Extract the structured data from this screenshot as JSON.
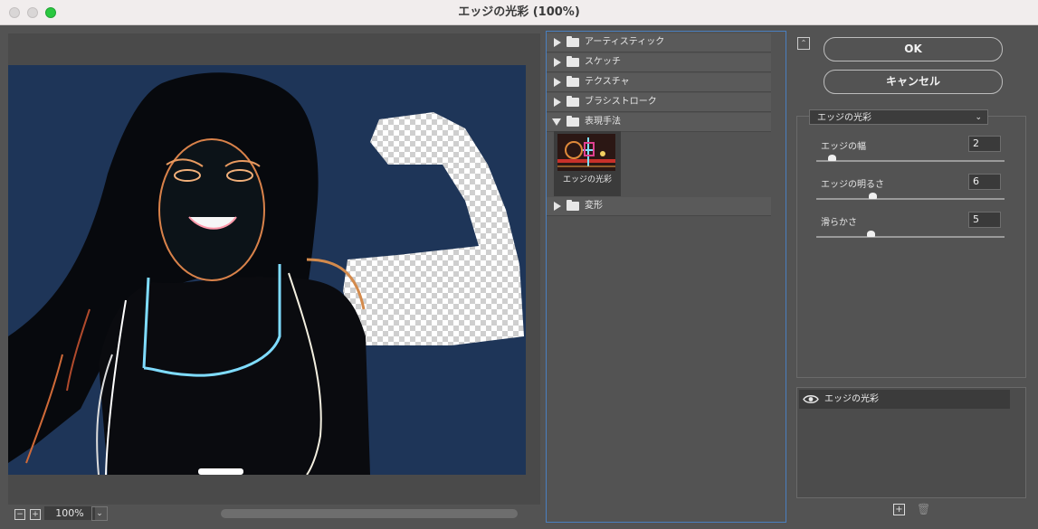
{
  "window": {
    "title": "エッジの光彩 (100%)"
  },
  "preview": {
    "zoom": "100%",
    "zoom_out": "−",
    "zoom_in": "+"
  },
  "filter_groups": [
    {
      "label": "アーティスティック",
      "expanded": false
    },
    {
      "label": "スケッチ",
      "expanded": false
    },
    {
      "label": "テクスチャ",
      "expanded": false
    },
    {
      "label": "ブラシストローク",
      "expanded": false
    },
    {
      "label": "表現手法",
      "expanded": true
    },
    {
      "label": "変形",
      "expanded": false
    }
  ],
  "selected_filter": {
    "label": "エッジの光彩"
  },
  "buttons": {
    "ok": "OK",
    "cancel": "キャンセル"
  },
  "filter_select": {
    "value": "エッジの光彩"
  },
  "params": [
    {
      "label": "エッジの幅",
      "value": "2",
      "level": 0.08
    },
    {
      "label": "エッジの明るさ",
      "value": "6",
      "level": 0.3
    },
    {
      "label": "滑らかさ",
      "value": "5",
      "level": 0.29
    }
  ],
  "layers": [
    {
      "label": "エッジの光彩",
      "visible": true
    }
  ],
  "colors": {
    "accent_border": "#4a7fbf",
    "canvas_bg": "#1e3558"
  },
  "icons": {
    "collapse": "collapse-up-icon",
    "eye": "eye-icon",
    "new_layer": "new-effect-layer-icon",
    "delete": "trash-icon"
  }
}
